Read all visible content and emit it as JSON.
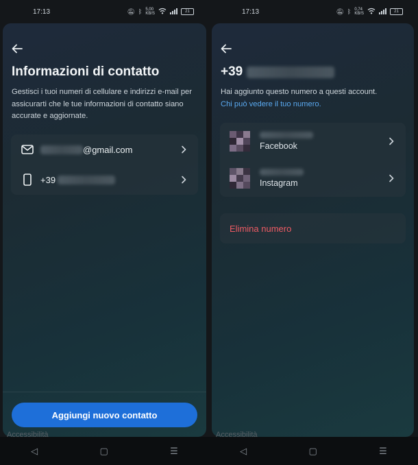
{
  "left": {
    "status": {
      "time": "17:13",
      "net_speed": "5,00\nKB/S",
      "battery": "21"
    },
    "title": "Informazioni di contatto",
    "description": "Gestisci i tuoi numeri di cellulare e indirizzi e-mail per assicurarti che le tue informazioni di contatto siano accurate e aggiornate.",
    "contacts": {
      "email_suffix": "@gmail.com",
      "phone_prefix": "+39"
    },
    "add_button": "Aggiungi nuovo contatto",
    "behind_label": "Accessibilità"
  },
  "right": {
    "status": {
      "time": "17:13",
      "net_speed": "0,74\nKB/S",
      "battery": "21"
    },
    "title_prefix": "+39",
    "description": "Hai aggiunto questo numero a questi account. ",
    "description_link": "Chi può vedere il tuo numero.",
    "accounts": [
      {
        "platform": "Facebook"
      },
      {
        "platform": "Instagram"
      }
    ],
    "delete_label": "Elimina numero",
    "behind_label": "Accessibilità"
  },
  "nav": {
    "back": "◁",
    "home": "▢",
    "menu": "☰"
  },
  "colors": {
    "accent": "#1e6fd9",
    "link": "#5aa9f0",
    "danger": "#ee5b64"
  }
}
